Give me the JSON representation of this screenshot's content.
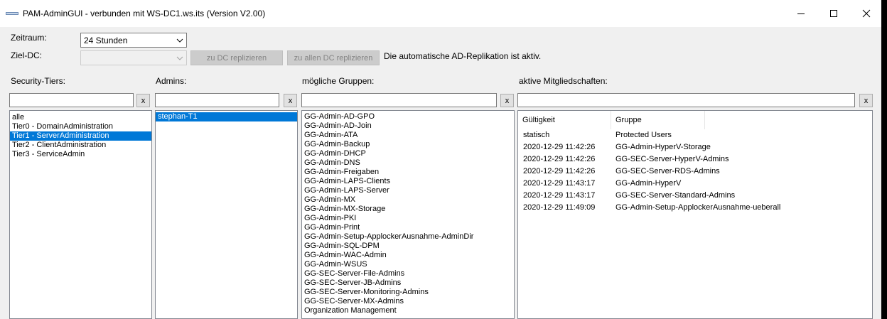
{
  "window": {
    "title": "PAM-AdminGUI - verbunden mit WS-DC1.ws.its (Version V2.00)"
  },
  "zeitraum": {
    "label": "Zeitraum:",
    "value": "24 Stunden"
  },
  "ziel_dc": {
    "label": "Ziel-DC:",
    "value": "",
    "btn_replicate": "zu DC replizieren",
    "btn_replicate_all": "zu allen DC replizieren",
    "status": "Die automatische AD-Replikation ist aktiv."
  },
  "columns": {
    "tiers_label": "Security-Tiers:",
    "admins_label": "Admins:",
    "groups_label": "mögliche Gruppen:",
    "memberships_label": "aktive Mitgliedschaften:",
    "clear_label": "x"
  },
  "tiers": [
    {
      "name": "alle",
      "selected": false
    },
    {
      "name": "Tier0 - DomainAdministration",
      "selected": false
    },
    {
      "name": "Tier1 - ServerAdministration",
      "selected": true
    },
    {
      "name": "Tier2 - ClientAdministration",
      "selected": false
    },
    {
      "name": "Tier3 - ServiceAdmin",
      "selected": false
    }
  ],
  "admins": [
    {
      "name": "stephan-T1",
      "selected": true
    }
  ],
  "groups": [
    "GG-Admin-AD-GPO",
    "GG-Admin-AD-Join",
    "GG-Admin-ATA",
    "GG-Admin-Backup",
    "GG-Admin-DHCP",
    "GG-Admin-DNS",
    "GG-Admin-Freigaben",
    "GG-Admin-LAPS-Clients",
    "GG-Admin-LAPS-Server",
    "GG-Admin-MX",
    "GG-Admin-MX-Storage",
    "GG-Admin-PKI",
    "GG-Admin-Print",
    "GG-Admin-Setup-ApplockerAusnahme-AdminDir",
    "GG-Admin-SQL-DPM",
    "GG-Admin-WAC-Admin",
    "GG-Admin-WSUS",
    "GG-SEC-Server-File-Admins",
    "GG-SEC-Server-JB-Admins",
    "GG-SEC-Server-Monitoring-Admins",
    "GG-SEC-Server-MX-Admins",
    "Organization Management"
  ],
  "memberships": {
    "headers": [
      "Gültigkeit",
      "Gruppe"
    ],
    "rows": [
      [
        "statisch",
        "Protected Users"
      ],
      [
        "2020-12-29 11:42:26",
        "GG-Admin-HyperV-Storage"
      ],
      [
        "2020-12-29 11:42:26",
        "GG-SEC-Server-HyperV-Admins"
      ],
      [
        "2020-12-29 11:42:26",
        "GG-SEC-Server-RDS-Admins"
      ],
      [
        "2020-12-29 11:43:17",
        "GG-Admin-HyperV"
      ],
      [
        "2020-12-29 11:43:17",
        "GG-SEC-Server-Standard-Admins"
      ],
      [
        "2020-12-29 11:49:09",
        "GG-Admin-Setup-ApplockerAusnahme-ueberall"
      ]
    ]
  }
}
